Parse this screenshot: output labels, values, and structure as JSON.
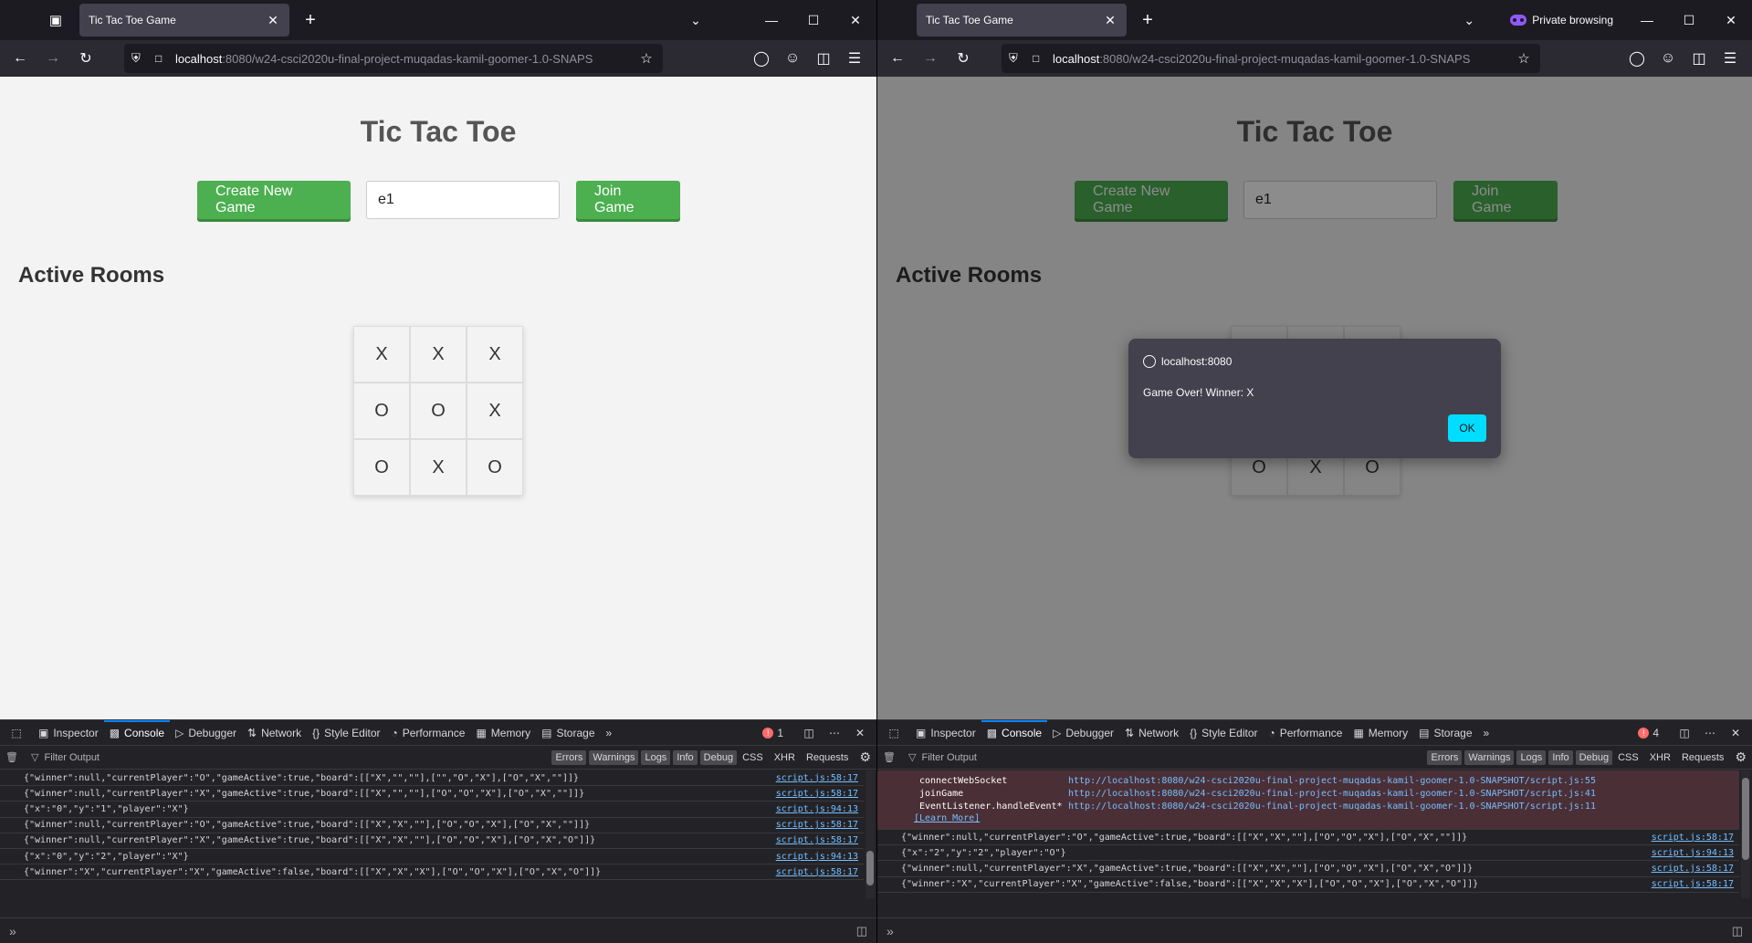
{
  "browser": {
    "tab_title": "Tic Tac Toe Game",
    "url_host": "localhost",
    "url_path": ":8080/w24-csci2020u-final-project-muqadas-kamil-goomer-1.0-SNAPS",
    "private_label": "Private browsing"
  },
  "page": {
    "title": "Tic Tac Toe",
    "create_label": "Create New Game",
    "game_id_value": "e1",
    "join_label": "Join Game",
    "rooms_title": "Active Rooms"
  },
  "board": [
    "X",
    "X",
    "X",
    "O",
    "O",
    "X",
    "O",
    "X",
    "O"
  ],
  "dialog": {
    "origin": "localhost:8080",
    "message": "Game Over! Winner: X",
    "ok_label": "OK"
  },
  "devtools": {
    "tabs": [
      "Inspector",
      "Console",
      "Debugger",
      "Network",
      "Style Editor",
      "Performance",
      "Memory",
      "Storage"
    ],
    "filter_placeholder": "Filter Output",
    "filters": [
      "Errors",
      "Warnings",
      "Logs",
      "Info",
      "Debug"
    ],
    "extra_filters": [
      "CSS",
      "XHR",
      "Requests"
    ],
    "left_error_count": "1",
    "right_error_count": "4",
    "left_logs": [
      {
        "msg": "{\"winner\":null,\"currentPlayer\":\"O\",\"gameActive\":true,\"board\":[[\"X\",\"\",\"\"],[\"\",\"O\",\"X\"],[\"O\",\"X\",\"\"]]}",
        "src": "script.js:58:17"
      },
      {
        "msg": "{\"winner\":null,\"currentPlayer\":\"X\",\"gameActive\":true,\"board\":[[\"X\",\"\",\"\"],[\"O\",\"O\",\"X\"],[\"O\",\"X\",\"\"]]}",
        "src": "script.js:58:17"
      },
      {
        "msg": "{\"x\":\"0\",\"y\":\"1\",\"player\":\"X\"}",
        "src": "script.js:94:13"
      },
      {
        "msg": "{\"winner\":null,\"currentPlayer\":\"O\",\"gameActive\":true,\"board\":[[\"X\",\"X\",\"\"],[\"O\",\"O\",\"X\"],[\"O\",\"X\",\"\"]]}",
        "src": "script.js:58:17"
      },
      {
        "msg": "{\"winner\":null,\"currentPlayer\":\"X\",\"gameActive\":true,\"board\":[[\"X\",\"X\",\"\"],[\"O\",\"O\",\"X\"],[\"O\",\"X\",\"O\"]]}",
        "src": "script.js:58:17"
      },
      {
        "msg": "{\"x\":\"0\",\"y\":\"2\",\"player\":\"X\"}",
        "src": "script.js:94:13"
      },
      {
        "msg": "{\"winner\":\"X\",\"currentPlayer\":\"X\",\"gameActive\":false,\"board\":[[\"X\",\"X\",\"X\"],[\"O\",\"O\",\"X\"],[\"O\",\"X\",\"O\"]]}",
        "src": "script.js:58:17"
      }
    ],
    "right_error_frames": [
      {
        "fn": "connectWebSocket",
        "loc": "http://localhost:8080/w24-csci2020u-final-project-muqadas-kamil-goomer-1.0-SNAPSHOT/script.js:55"
      },
      {
        "fn": "joinGame",
        "loc": "http://localhost:8080/w24-csci2020u-final-project-muqadas-kamil-goomer-1.0-SNAPSHOT/script.js:41"
      },
      {
        "fn": "EventListener.handleEvent*",
        "loc": "http://localhost:8080/w24-csci2020u-final-project-muqadas-kamil-goomer-1.0-SNAPSHOT/script.js:11"
      }
    ],
    "learn_more": "[Learn More]",
    "right_logs": [
      {
        "msg": "{\"winner\":null,\"currentPlayer\":\"O\",\"gameActive\":true,\"board\":[[\"X\",\"X\",\"\"],[\"O\",\"O\",\"X\"],[\"O\",\"X\",\"\"]]}",
        "src": "script.js:58:17"
      },
      {
        "msg": "{\"x\":\"2\",\"y\":\"2\",\"player\":\"O\"}",
        "src": "script.js:94:13"
      },
      {
        "msg": "{\"winner\":null,\"currentPlayer\":\"X\",\"gameActive\":true,\"board\":[[\"X\",\"X\",\"\"],[\"O\",\"O\",\"X\"],[\"O\",\"X\",\"O\"]]}",
        "src": "script.js:58:17"
      },
      {
        "msg": "{\"winner\":\"X\",\"currentPlayer\":\"X\",\"gameActive\":false,\"board\":[[\"X\",\"X\",\"X\"],[\"O\",\"O\",\"X\"],[\"O\",\"X\",\"O\"]]}",
        "src": "script.js:58:17"
      }
    ]
  },
  "icons": {
    "tabs_menu": "tab-list-icon",
    "close": "close-icon",
    "back": "back-arrow-icon",
    "forward": "forward-arrow-icon",
    "reload": "reload-icon",
    "shield": "shield-icon",
    "bookmark": "star-icon",
    "pocket": "pocket-icon",
    "account": "account-icon",
    "extensions": "puzzle-icon",
    "menu": "hamburger-icon"
  },
  "colors": {
    "accent_green": "#4caf50",
    "ok_button": "#00ddff",
    "devtools_bg": "#232327"
  }
}
